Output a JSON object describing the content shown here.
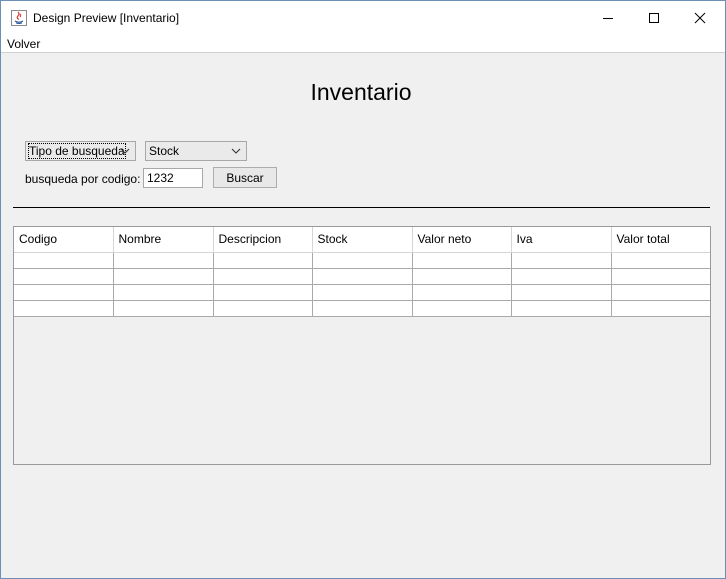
{
  "window": {
    "title": "Design Preview [Inventario]"
  },
  "menu": {
    "items": [
      {
        "label": "Volver"
      }
    ]
  },
  "page": {
    "title": "Inventario"
  },
  "search": {
    "type_combo": {
      "selected": "Tipo de busqueda"
    },
    "stock_combo": {
      "selected": "Stock"
    },
    "code_label": "busqueda por codigo:",
    "code_value": "1232",
    "search_button": "Buscar"
  },
  "table": {
    "columns": [
      "Codigo",
      "Nombre",
      "Descripcion",
      "Stock",
      "Valor neto",
      "Iva",
      "Valor total"
    ],
    "rows": [
      [
        "",
        "",
        "",
        "",
        "",
        "",
        ""
      ],
      [
        "",
        "",
        "",
        "",
        "",
        "",
        ""
      ],
      [
        "",
        "",
        "",
        "",
        "",
        "",
        ""
      ],
      [
        "",
        "",
        "",
        "",
        "",
        "",
        ""
      ]
    ]
  }
}
